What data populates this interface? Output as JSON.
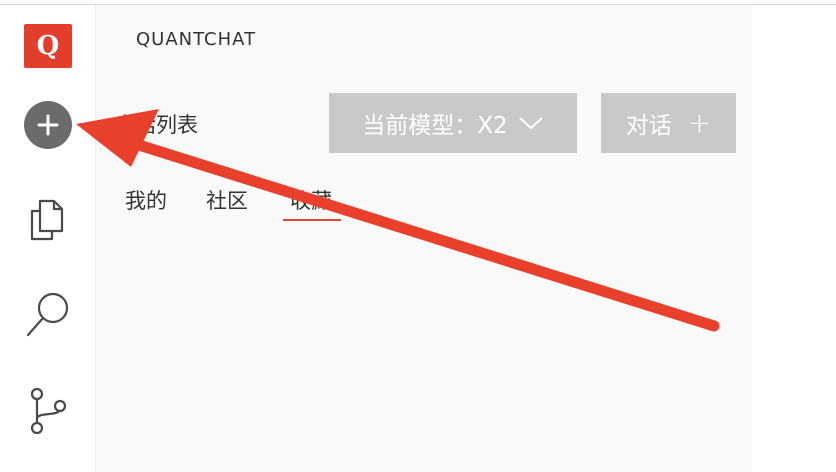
{
  "sidebar": {
    "logo_letter": "Q",
    "logo_color": "#e33e2b",
    "icons": [
      "plus-icon",
      "copy-icon",
      "search-icon",
      "branch-icon"
    ]
  },
  "header": {
    "brand": "QUANTCHAT"
  },
  "main": {
    "list_title": "会话列表",
    "model_button": "当前模型：X2",
    "chat_button": "对话",
    "chat_plus": "+",
    "tabs": [
      {
        "label": "我的"
      },
      {
        "label": "社区"
      },
      {
        "label": "收藏",
        "active": true
      }
    ]
  },
  "annotation": {
    "arrow_color": "#e8402b"
  }
}
